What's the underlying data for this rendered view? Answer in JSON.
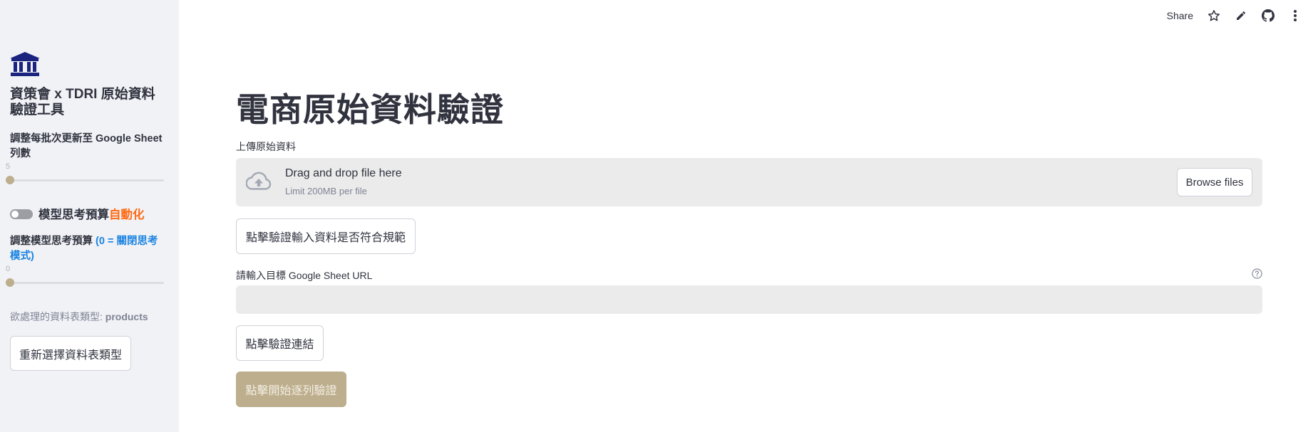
{
  "header": {
    "share_label": "Share",
    "icons": [
      "star-icon",
      "edit-icon",
      "github-icon",
      "more-icon"
    ]
  },
  "sidebar": {
    "logo_icon": "bank-building-icon",
    "title": "資策會 x TDRI 原始資料驗證工具",
    "rows_slider": {
      "label": "調整每批次更新至 Google Sheet 列數",
      "value": "5",
      "fraction": 0.0
    },
    "thinking_toggle": {
      "label_main": "模型思考預算",
      "label_accent": "自動化",
      "on": false
    },
    "budget_slider": {
      "label_main": "調整模型思考預算 ",
      "label_accent": "(0 = 關閉思考模式)",
      "value": "0",
      "fraction": 0.0
    },
    "table_type": {
      "prefix": "欲處理的資料表類型: ",
      "value": "products"
    },
    "reselect_button": "重新選擇資料表類型"
  },
  "main": {
    "title": "電商原始資料驗證",
    "upload": {
      "label": "上傳原始資料",
      "drop_text": "Drag and drop file here",
      "limit_text": "Limit 200MB per file",
      "browse_button": "Browse files"
    },
    "validate_input_button": "點擊驗證輸入資料是否符合規範",
    "sheet_url": {
      "label": "請輸入目標 Google Sheet URL",
      "value": "",
      "placeholder": ""
    },
    "validate_link_button": "點擊驗證連結",
    "start_button": "點擊開始逐列驗證"
  },
  "colors": {
    "accent_orange": "#ff6a13",
    "accent_blue": "#1c83e1",
    "disabled_button": "#bdae8d",
    "sidebar_bg": "#f0f2f6",
    "logo_navy": "#1a237e"
  }
}
